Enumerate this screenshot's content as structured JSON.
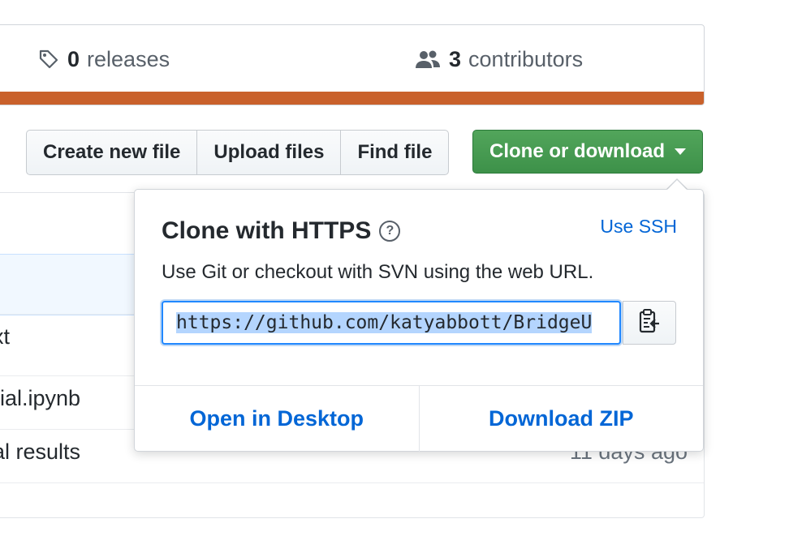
{
  "summary": {
    "releases": {
      "count": "0",
      "label": "releases",
      "icon": "tag-icon"
    },
    "contributors": {
      "count": "3",
      "label": "contributors",
      "icon": "people-icon"
    },
    "language_color": "#c9612b"
  },
  "toolbar": {
    "create_label": "Create new file",
    "upload_label": "Upload files",
    "find_label": "Find file",
    "clone_label": "Clone or download"
  },
  "files": [
    {
      "name": "xt",
      "age": ""
    },
    {
      "name": "rial.ipynb",
      "age": ""
    },
    {
      "name": "al results",
      "age": "11 days ago"
    }
  ],
  "clone_popover": {
    "title": "Clone with HTTPS",
    "use_ssh": "Use SSH",
    "description": "Use Git or checkout with SVN using the web URL.",
    "url": "https://github.com/katyabbott/BridgeU",
    "open_desktop": "Open in Desktop",
    "download_zip": "Download ZIP"
  },
  "colors": {
    "primary_green": "#3d9149",
    "link_blue": "#0366d6"
  }
}
